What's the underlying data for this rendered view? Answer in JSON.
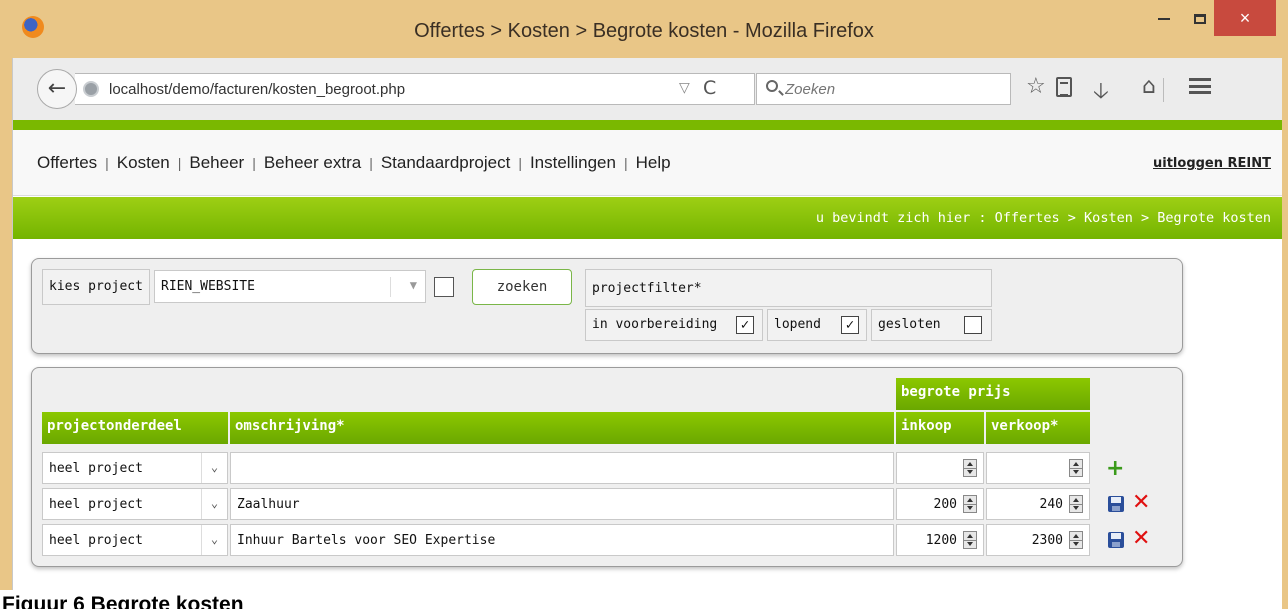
{
  "window": {
    "title": "Offertes > Kosten > Begrote kosten - Mozilla Firefox",
    "minimize_glyph": "",
    "maximize_glyph": "",
    "close_glyph": "×"
  },
  "browser": {
    "url": "localhost/demo/facturen/kosten_begroot.php",
    "search_placeholder": "Zoeken",
    "reload_glyph": "C",
    "dropdown_glyph": "▽"
  },
  "menu": {
    "items": [
      "Offertes",
      "Kosten",
      "Beheer",
      "Beheer extra",
      "Standaardproject",
      "Instellingen",
      "Help"
    ],
    "separator": "|",
    "logout": "uitloggen REINT"
  },
  "breadcrumb": "u bevindt zich hier : Offertes > Kosten > Begrote kosten",
  "search_panel": {
    "project_label": "kies project",
    "project_value": "RIEN_WEBSITE",
    "search_button": "zoeken",
    "filter_label": "projectfilter*",
    "filters": [
      {
        "label": "in voorbereiding",
        "checked": true
      },
      {
        "label": "lopend",
        "checked": true
      },
      {
        "label": "gesloten",
        "checked": false
      }
    ]
  },
  "table": {
    "group_header": "begrote prijs",
    "headers": {
      "projectonderdeel": "projectonderdeel",
      "omschrijving": "omschrijving*",
      "inkoop": "inkoop",
      "verkoop": "verkoop*"
    },
    "rows": [
      {
        "onderdeel": "heel project",
        "omschrijving": "",
        "inkoop": "",
        "verkoop": "",
        "actions": [
          "add"
        ]
      },
      {
        "onderdeel": "heel project",
        "omschrijving": "Zaalhuur",
        "inkoop": "200",
        "verkoop": "240",
        "actions": [
          "save",
          "delete"
        ]
      },
      {
        "onderdeel": "heel project",
        "omschrijving": "Inhuur Bartels voor SEO Expertise",
        "inkoop": "1200",
        "verkoop": "2300",
        "actions": [
          "save",
          "delete"
        ]
      }
    ]
  },
  "caption": "Figuur 6 Begrote kosten",
  "icons": {
    "back": "back-arrow-icon",
    "star": "bookmark-star-icon",
    "reading_list": "reading-list-icon",
    "download": "download-icon",
    "home": "home-icon",
    "menu": "hamburger-menu-icon",
    "add": "plus-icon",
    "save": "floppy-disk-icon",
    "delete": "red-x-icon"
  },
  "colors": {
    "accent_green": "#7ab800",
    "titlebar": "#e9c687",
    "close_button": "#c84a3e"
  }
}
